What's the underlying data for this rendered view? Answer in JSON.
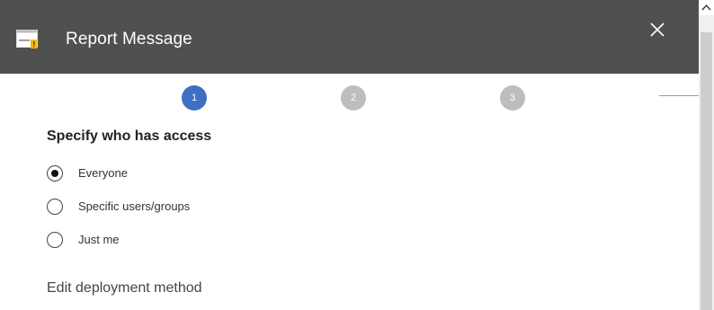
{
  "header": {
    "title": "Report Message",
    "app_icon": "report-message-icon",
    "close_icon": "close-icon"
  },
  "steps": [
    {
      "label": "1",
      "state": "active"
    },
    {
      "label": "2",
      "state": "inactive"
    },
    {
      "label": "3",
      "state": "inactive"
    }
  ],
  "access": {
    "heading": "Specify who has access",
    "options": [
      {
        "label": "Everyone",
        "selected": true
      },
      {
        "label": "Specific users/groups",
        "selected": false
      },
      {
        "label": "Just me",
        "selected": false
      }
    ]
  },
  "footer": {
    "edit_deployment_label": "Edit deployment method"
  },
  "colors": {
    "header_bg": "#505050",
    "step_active": "#3d6fc5",
    "step_inactive": "#bdbdbd"
  }
}
